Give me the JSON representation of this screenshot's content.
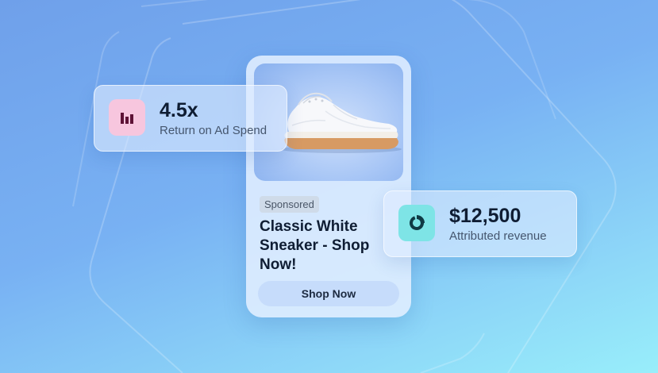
{
  "theme": {
    "background_top": "#6fa0ea",
    "background_bottom": "#98eefa",
    "card_background": "#e1eeff",
    "roas_icon_bg": "#f7c6de",
    "roas_icon_color": "#5e1236",
    "revenue_icon_bg": "#7ee4e6",
    "revenue_icon_color": "#0f3a44"
  },
  "product_card": {
    "image": "white-sneaker",
    "badge": "Sponsored",
    "title": "Classic White Sneaker - Shop Now!",
    "button_label": "Shop Now"
  },
  "roas_card": {
    "icon": "bar-chart-icon",
    "value": "4.5x",
    "label": "Return on Ad Spend"
  },
  "revenue_card": {
    "icon": "pie-chart-icon",
    "value": "$12,500",
    "label": "Attributed revenue"
  }
}
